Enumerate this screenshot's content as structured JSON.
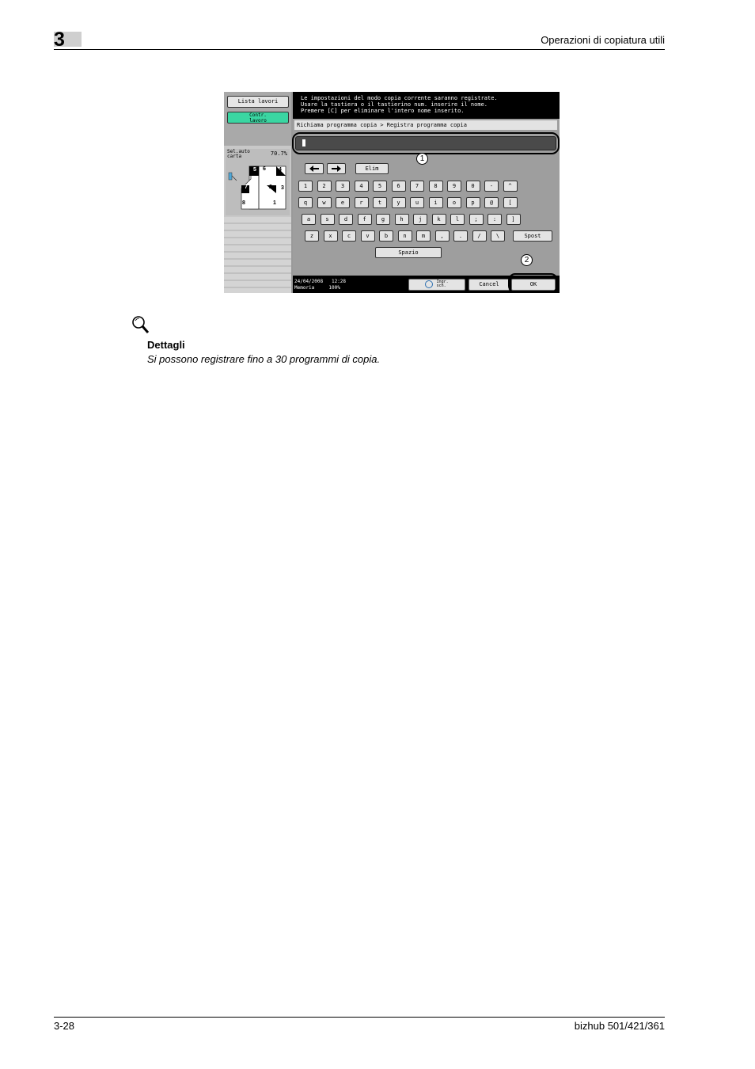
{
  "header": {
    "chapter": "3",
    "title": "Operazioni di copiatura utili"
  },
  "screen": {
    "left_panel": {
      "job_list_button": "Lista lavori",
      "check_job_button": [
        "Contr.",
        "lavoro"
      ],
      "info_label": [
        "Sel.auto",
        "carta"
      ],
      "zoom": "70.7%",
      "diagram_numbers": [
        "5",
        "6",
        "4",
        "7",
        "2",
        "3",
        "8",
        "1"
      ]
    },
    "message": [
      "Le impostazioni del modo copia corrente saranno registrate.",
      "Usare la tastiera o il tastierino num. inserire il nome.",
      "Premere [C] per eliminare l'intero nome inserito."
    ],
    "breadcrumb": "Richiama programma copia > Registra programma copia",
    "name_value": "",
    "delete_button": "Elim",
    "keyboard": {
      "row1": [
        "1",
        "2",
        "3",
        "4",
        "5",
        "6",
        "7",
        "8",
        "9",
        "0",
        "-",
        "^"
      ],
      "row2": [
        "q",
        "w",
        "e",
        "r",
        "t",
        "y",
        "u",
        "i",
        "o",
        "p",
        "@",
        "["
      ],
      "row3": [
        "a",
        "s",
        "d",
        "f",
        "g",
        "h",
        "j",
        "k",
        "l",
        ";",
        ":",
        "]"
      ],
      "row4": [
        "z",
        "x",
        "c",
        "v",
        "b",
        "n",
        "m",
        ",",
        ".",
        "/",
        "\\"
      ],
      "shift": "Spost",
      "space": "Spazio"
    },
    "callouts": [
      "1",
      "2"
    ],
    "status": {
      "date": "24/04/2008",
      "time": "12:28",
      "memory_label": "Memoria",
      "memory_value": "100%"
    },
    "buttons": {
      "enlarge": [
        "Ingr.",
        "sch."
      ],
      "cancel": "Cancel",
      "ok": "OK"
    }
  },
  "note": {
    "title": "Dettagli",
    "text": "Si possono registrare fino a 30 programmi di copia."
  },
  "footer": {
    "page": "3-28",
    "product": "bizhub 501/421/361"
  }
}
